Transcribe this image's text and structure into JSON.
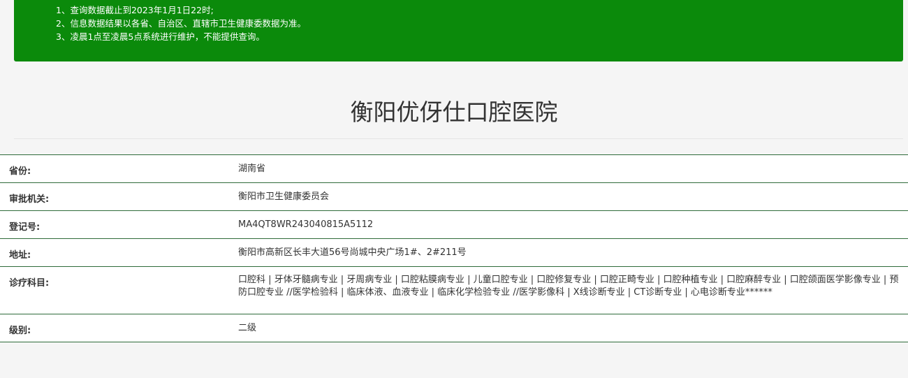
{
  "notice": {
    "lines": [
      "1、查询数据截止到2023年1月1日22时;",
      "2、信息数据结果以各省、自治区、直辖市卫生健康委数据为准。",
      "3、凌晨1点至凌晨5点系统进行维护，不能提供查询。"
    ]
  },
  "page_title": "衡阳优伢仕口腔医院",
  "info": {
    "rows": [
      {
        "label": "省份:",
        "value": "湖南省"
      },
      {
        "label": "审批机关:",
        "value": "衡阳市卫生健康委员会"
      },
      {
        "label": "登记号:",
        "value": "MA4QT8WR243040815A5112"
      },
      {
        "label": "地址:",
        "value": "衡阳市高新区长丰大道56号尚城中央广场1#、2#211号"
      },
      {
        "label": "诊疗科目:",
        "value": "口腔科 | 牙体牙髓病专业 | 牙周病专业 | 口腔粘膜病专业 | 儿童口腔专业 | 口腔修复专业 | 口腔正畸专业 | 口腔种植专业 | 口腔麻醉专业 | 口腔颌面医学影像专业 | 预防口腔专业 //医学检验科 | 临床体液、血液专业 | 临床化学检验专业 //医学影像科 | X线诊断专业 | CT诊断专业 | 心电诊断专业******"
      },
      {
        "label": "级别:",
        "value": "二级"
      }
    ]
  },
  "colors": {
    "notice_bg": "#0b8a0b",
    "row_border": "#2f6b3a"
  }
}
